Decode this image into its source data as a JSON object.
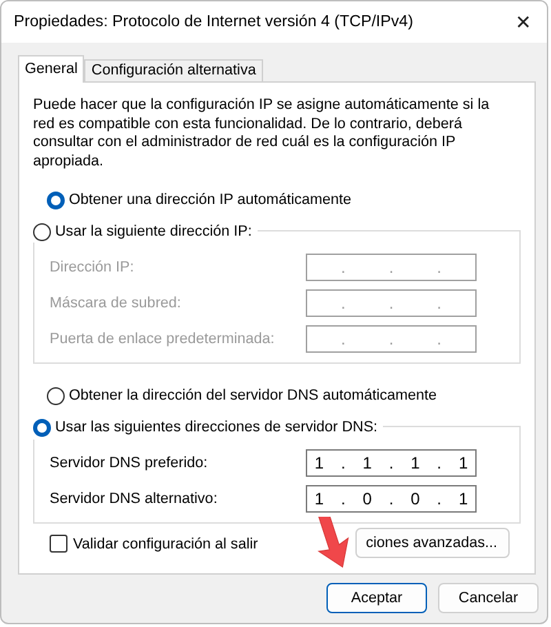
{
  "window": {
    "title": "Propiedades: Protocolo de Internet versión 4 (TCP/IPv4)",
    "close": "✕"
  },
  "tabs": [
    {
      "label": "General",
      "selected": true
    },
    {
      "label": "Configuración alternativa",
      "selected": false
    }
  ],
  "description": "Puede hacer que la configuración IP se asigne automáticamente si la red es compatible con esta funcionalidad. De lo contrario, deberá consultar con el administrador de red cuál es la configuración IP apropiada.",
  "ip_auto": {
    "label": "Obtener una dirección IP automáticamente",
    "selected": true
  },
  "ip_manual": {
    "label": "Usar la siguiente dirección IP:",
    "selected": false,
    "disabled": true,
    "fields": [
      {
        "label": "Dirección IP:",
        "dots": [
          ".",
          ".",
          "."
        ]
      },
      {
        "label": "Máscara de subred:",
        "dots": [
          ".",
          ".",
          "."
        ]
      },
      {
        "label": "Puerta de enlace predeterminada:",
        "dots": [
          ".",
          ".",
          "."
        ]
      }
    ]
  },
  "dns_auto": {
    "label": "Obtener la dirección del servidor DNS automáticamente",
    "selected": false
  },
  "dns_manual": {
    "label": "Usar las siguientes direcciones de servidor DNS:",
    "selected": true,
    "disabled": false,
    "fields": [
      {
        "label": "Servidor DNS preferido:",
        "dots": [
          ".",
          ".",
          "."
        ],
        "octets": [
          "1",
          "1",
          "1",
          "1"
        ]
      },
      {
        "label": "Servidor DNS alternativo:",
        "dots": [
          ".",
          ".",
          "."
        ],
        "octets": [
          "1",
          "0",
          "0",
          "1"
        ]
      }
    ]
  },
  "validate": {
    "label": "Validar configuración al salir",
    "checked": false
  },
  "advanced_button": "ciones avanzadas...",
  "buttons": [
    {
      "label": "Aceptar",
      "default": true
    },
    {
      "label": "Cancelar",
      "default": false
    }
  ]
}
